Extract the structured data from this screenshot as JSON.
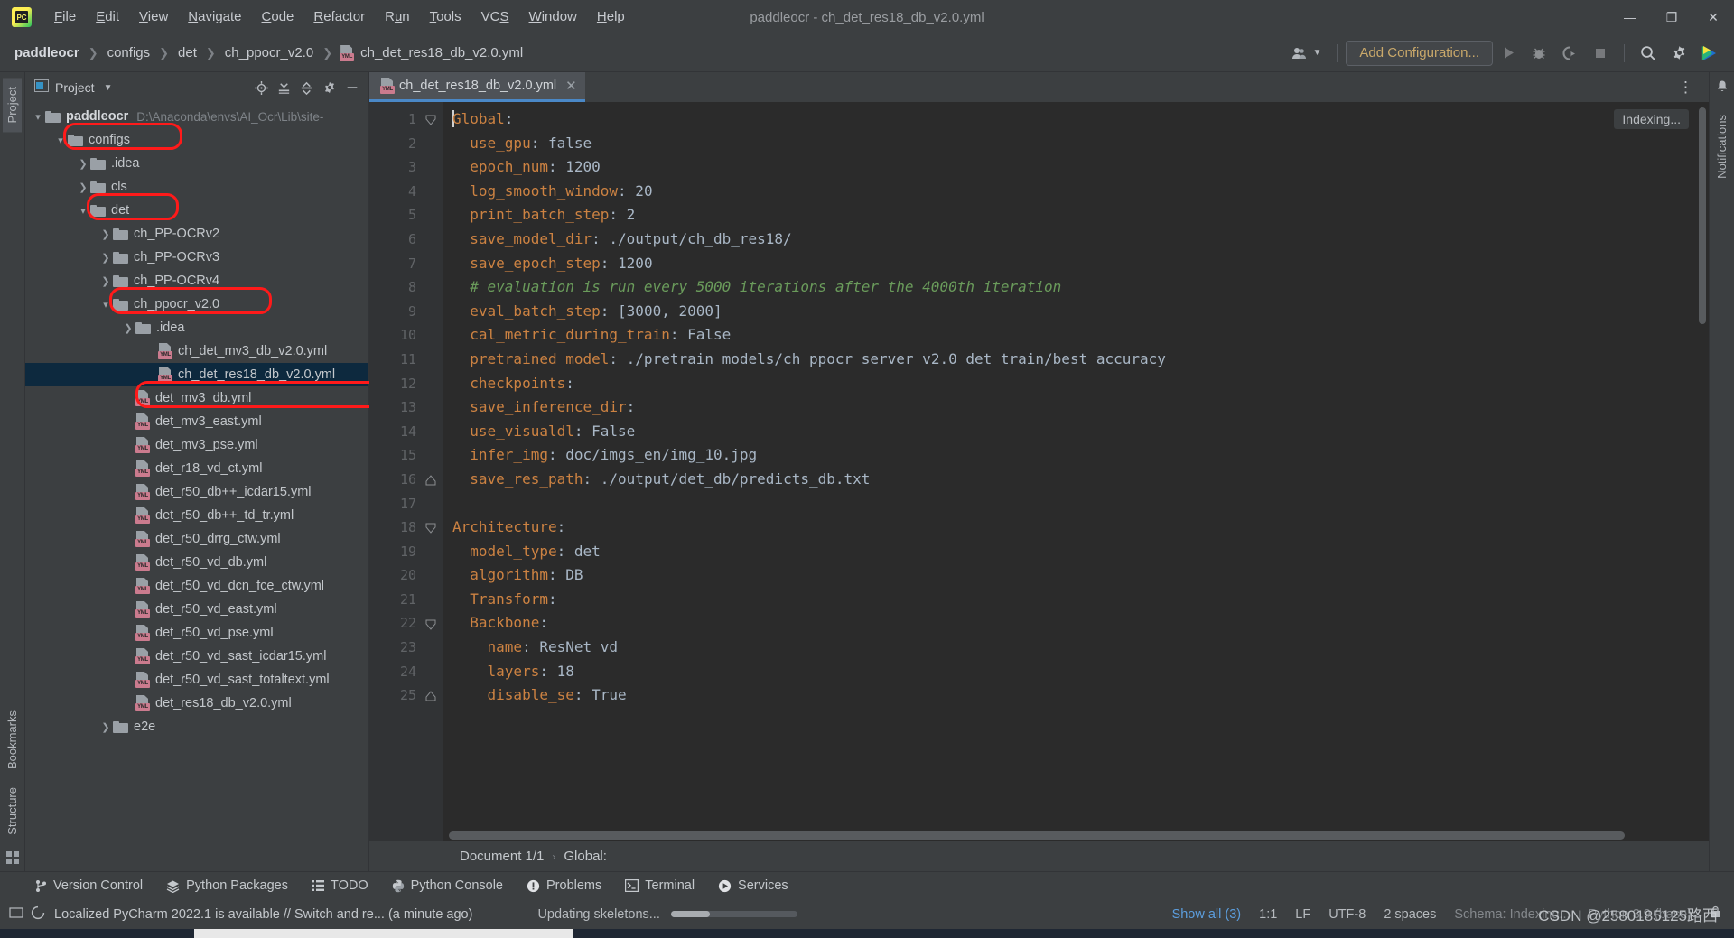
{
  "window": {
    "title": "paddleocr - ch_det_res18_db_v2.0.yml",
    "minimize": "—",
    "maximize": "❐",
    "close": "✕",
    "logo_text": "PC"
  },
  "menu": [
    "File",
    "Edit",
    "View",
    "Navigate",
    "Code",
    "Refactor",
    "Run",
    "Tools",
    "VCS",
    "Window",
    "Help"
  ],
  "navbar": {
    "breadcrumbs": [
      "paddleocr",
      "configs",
      "det",
      "ch_ppocr_v2.0",
      "ch_det_res18_db_v2.0.yml"
    ],
    "yml_badge": "YML",
    "add_configuration": "Add Configuration...",
    "icons": [
      "user-icon",
      "run-icon",
      "debug-icon",
      "coverage-icon",
      "stop-icon",
      "search-icon",
      "settings-icon",
      "app-logo-icon"
    ]
  },
  "left_rail": {
    "tabs": [
      "Project",
      "Bookmarks",
      "Structure"
    ]
  },
  "project_panel": {
    "title": "Project",
    "header_icons": [
      "locate-icon",
      "expand-all-icon",
      "collapse-all-icon",
      "settings-icon",
      "hide-icon"
    ],
    "tree": [
      {
        "label": "paddleocr",
        "path": "D:\\Anaconda\\envs\\AI_Ocr\\Lib\\site-",
        "indent": 0,
        "arrow": "down",
        "type": "folder",
        "bold": true
      },
      {
        "label": "configs",
        "path": "",
        "indent": 1,
        "arrow": "down",
        "type": "folder",
        "bold": false
      },
      {
        "label": ".idea",
        "path": "",
        "indent": 2,
        "arrow": "right",
        "type": "folder",
        "bold": false
      },
      {
        "label": "cls",
        "path": "",
        "indent": 2,
        "arrow": "right",
        "type": "folder",
        "bold": false
      },
      {
        "label": "det",
        "path": "",
        "indent": 2,
        "arrow": "down",
        "type": "folder",
        "bold": false
      },
      {
        "label": "ch_PP-OCRv2",
        "path": "",
        "indent": 3,
        "arrow": "right",
        "type": "folder",
        "bold": false
      },
      {
        "label": "ch_PP-OCRv3",
        "path": "",
        "indent": 3,
        "arrow": "right",
        "type": "folder",
        "bold": false
      },
      {
        "label": "ch_PP-OCRv4",
        "path": "",
        "indent": 3,
        "arrow": "right",
        "type": "folder",
        "bold": false
      },
      {
        "label": "ch_ppocr_v2.0",
        "path": "",
        "indent": 3,
        "arrow": "down",
        "type": "folder",
        "bold": false
      },
      {
        "label": ".idea",
        "path": "",
        "indent": 4,
        "arrow": "right",
        "type": "folder",
        "bold": false
      },
      {
        "label": "ch_det_mv3_db_v2.0.yml",
        "path": "",
        "indent": 5,
        "arrow": "none",
        "type": "yml",
        "bold": false
      },
      {
        "label": "ch_det_res18_db_v2.0.yml",
        "path": "",
        "indent": 5,
        "arrow": "none",
        "type": "yml",
        "bold": false,
        "selected": true
      },
      {
        "label": "det_mv3_db.yml",
        "path": "",
        "indent": 4,
        "arrow": "none",
        "type": "yml",
        "bold": false
      },
      {
        "label": "det_mv3_east.yml",
        "path": "",
        "indent": 4,
        "arrow": "none",
        "type": "yml",
        "bold": false
      },
      {
        "label": "det_mv3_pse.yml",
        "path": "",
        "indent": 4,
        "arrow": "none",
        "type": "yml",
        "bold": false
      },
      {
        "label": "det_r18_vd_ct.yml",
        "path": "",
        "indent": 4,
        "arrow": "none",
        "type": "yml",
        "bold": false
      },
      {
        "label": "det_r50_db++_icdar15.yml",
        "path": "",
        "indent": 4,
        "arrow": "none",
        "type": "yml",
        "bold": false
      },
      {
        "label": "det_r50_db++_td_tr.yml",
        "path": "",
        "indent": 4,
        "arrow": "none",
        "type": "yml",
        "bold": false
      },
      {
        "label": "det_r50_drrg_ctw.yml",
        "path": "",
        "indent": 4,
        "arrow": "none",
        "type": "yml",
        "bold": false
      },
      {
        "label": "det_r50_vd_db.yml",
        "path": "",
        "indent": 4,
        "arrow": "none",
        "type": "yml",
        "bold": false
      },
      {
        "label": "det_r50_vd_dcn_fce_ctw.yml",
        "path": "",
        "indent": 4,
        "arrow": "none",
        "type": "yml",
        "bold": false
      },
      {
        "label": "det_r50_vd_east.yml",
        "path": "",
        "indent": 4,
        "arrow": "none",
        "type": "yml",
        "bold": false
      },
      {
        "label": "det_r50_vd_pse.yml",
        "path": "",
        "indent": 4,
        "arrow": "none",
        "type": "yml",
        "bold": false
      },
      {
        "label": "det_r50_vd_sast_icdar15.yml",
        "path": "",
        "indent": 4,
        "arrow": "none",
        "type": "yml",
        "bold": false
      },
      {
        "label": "det_r50_vd_sast_totaltext.yml",
        "path": "",
        "indent": 4,
        "arrow": "none",
        "type": "yml",
        "bold": false
      },
      {
        "label": "det_res18_db_v2.0.yml",
        "path": "",
        "indent": 4,
        "arrow": "none",
        "type": "yml",
        "bold": false
      },
      {
        "label": "e2e",
        "path": "",
        "indent": 3,
        "arrow": "right",
        "type": "folder",
        "bold": false
      }
    ],
    "annotations": [
      "configs",
      "det",
      "ch_ppocr_v2.0",
      "ch_det_res18_db_v2.0.yml"
    ]
  },
  "editor": {
    "tab_label": "ch_det_res18_db_v2.0.yml",
    "tab_badge": "YML",
    "tab_close": "✕",
    "indexing_label": "Indexing...",
    "overflow_menu": "⋮",
    "lines": [
      {
        "n": 1,
        "indent": 0,
        "key": "Global",
        "sep": ":",
        "value": "",
        "comment": "",
        "fold": "open",
        "caret": true
      },
      {
        "n": 2,
        "indent": 1,
        "key": "use_gpu",
        "sep": ":",
        "value": "false",
        "comment": "",
        "fold": ""
      },
      {
        "n": 3,
        "indent": 1,
        "key": "epoch_num",
        "sep": ":",
        "value": "1200",
        "comment": "",
        "fold": ""
      },
      {
        "n": 4,
        "indent": 1,
        "key": "log_smooth_window",
        "sep": ":",
        "value": "20",
        "comment": "",
        "fold": ""
      },
      {
        "n": 5,
        "indent": 1,
        "key": "print_batch_step",
        "sep": ":",
        "value": "2",
        "comment": "",
        "fold": ""
      },
      {
        "n": 6,
        "indent": 1,
        "key": "save_model_dir",
        "sep": ":",
        "value": "./output/ch_db_res18/",
        "comment": "",
        "fold": ""
      },
      {
        "n": 7,
        "indent": 1,
        "key": "save_epoch_step",
        "sep": ":",
        "value": "1200",
        "comment": "",
        "fold": ""
      },
      {
        "n": 8,
        "indent": 1,
        "key": "",
        "sep": "",
        "value": "",
        "comment": "# evaluation is run every 5000 iterations after the 4000th iteration",
        "fold": ""
      },
      {
        "n": 9,
        "indent": 1,
        "key": "eval_batch_step",
        "sep": ":",
        "value": "[3000, 2000]",
        "comment": "",
        "fold": ""
      },
      {
        "n": 10,
        "indent": 1,
        "key": "cal_metric_during_train",
        "sep": ":",
        "value": "False",
        "comment": "",
        "fold": ""
      },
      {
        "n": 11,
        "indent": 1,
        "key": "pretrained_model",
        "sep": ":",
        "value": "./pretrain_models/ch_ppocr_server_v2.0_det_train/best_accuracy",
        "comment": "",
        "fold": ""
      },
      {
        "n": 12,
        "indent": 1,
        "key": "checkpoints",
        "sep": ":",
        "value": "",
        "comment": "",
        "fold": ""
      },
      {
        "n": 13,
        "indent": 1,
        "key": "save_inference_dir",
        "sep": ":",
        "value": "",
        "comment": "",
        "fold": ""
      },
      {
        "n": 14,
        "indent": 1,
        "key": "use_visualdl",
        "sep": ":",
        "value": "False",
        "comment": "",
        "fold": ""
      },
      {
        "n": 15,
        "indent": 1,
        "key": "infer_img",
        "sep": ":",
        "value": "doc/imgs_en/img_10.jpg",
        "comment": "",
        "fold": ""
      },
      {
        "n": 16,
        "indent": 1,
        "key": "save_res_path",
        "sep": ":",
        "value": "./output/det_db/predicts_db.txt",
        "comment": "",
        "fold": "end"
      },
      {
        "n": 17,
        "indent": 0,
        "key": "",
        "sep": "",
        "value": "",
        "comment": "",
        "fold": ""
      },
      {
        "n": 18,
        "indent": 0,
        "key": "Architecture",
        "sep": ":",
        "value": "",
        "comment": "",
        "fold": "open"
      },
      {
        "n": 19,
        "indent": 1,
        "key": "model_type",
        "sep": ":",
        "value": "det",
        "comment": "",
        "fold": ""
      },
      {
        "n": 20,
        "indent": 1,
        "key": "algorithm",
        "sep": ":",
        "value": "DB",
        "comment": "",
        "fold": ""
      },
      {
        "n": 21,
        "indent": 1,
        "key": "Transform",
        "sep": ":",
        "value": "",
        "comment": "",
        "fold": ""
      },
      {
        "n": 22,
        "indent": 1,
        "key": "Backbone",
        "sep": ":",
        "value": "",
        "comment": "",
        "fold": "open"
      },
      {
        "n": 23,
        "indent": 2,
        "key": "name",
        "sep": ":",
        "value": "ResNet_vd",
        "comment": "",
        "fold": ""
      },
      {
        "n": 24,
        "indent": 2,
        "key": "layers",
        "sep": ":",
        "value": "18",
        "comment": "",
        "fold": ""
      },
      {
        "n": 25,
        "indent": 2,
        "key": "disable_se",
        "sep": ":",
        "value": "True",
        "comment": "",
        "fold": "end"
      }
    ],
    "breadcrumb": {
      "document": "Document 1/1",
      "sep": "›",
      "node": "Global:"
    }
  },
  "right_rail": {
    "tabs": [
      "Notifications"
    ]
  },
  "tool_windows": [
    {
      "label": "Version Control",
      "icon": "branch-icon"
    },
    {
      "label": "Python Packages",
      "icon": "packages-icon"
    },
    {
      "label": "TODO",
      "icon": "list-icon"
    },
    {
      "label": "Python Console",
      "icon": "python-icon"
    },
    {
      "label": "Problems",
      "icon": "problems-icon"
    },
    {
      "label": "Terminal",
      "icon": "terminal-icon"
    },
    {
      "label": "Services",
      "icon": "services-icon"
    }
  ],
  "statusbar": {
    "message": "Localized PyCharm 2022.1 is available // Switch and re... (a minute ago)",
    "task": "Updating skeletons...",
    "show_all": "Show all (3)",
    "caret_position": "1:1",
    "line_separator": "LF",
    "encoding": "UTF-8",
    "indent": "2 spaces",
    "schema": "Schema: Indexing...",
    "interpreter": "Python 3.9 (base)",
    "watermark": "CSDN @2580185125路西"
  }
}
